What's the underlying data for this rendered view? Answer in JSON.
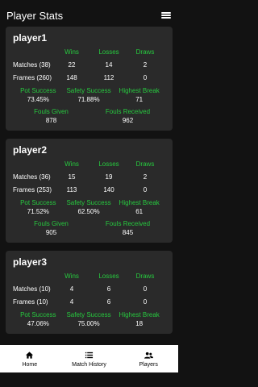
{
  "app": {
    "title": "Player Stats"
  },
  "headers": {
    "wins": "Wins",
    "losses": "Losses",
    "draws": "Draws",
    "pot": "Pot Success",
    "safety": "Safety Success",
    "highest": "Highest Break",
    "fouls_given": "Fouls Given",
    "fouls_received": "Fouls Received"
  },
  "players": [
    {
      "name": "player1",
      "matches": {
        "label": "Matches (38)",
        "wins": "22",
        "losses": "14",
        "draws": "2"
      },
      "frames": {
        "label": "Frames (260)",
        "wins": "148",
        "losses": "112",
        "draws": "0"
      },
      "pot": "73.45%",
      "safety": "71.88%",
      "highest": "71",
      "fouls_given": "878",
      "fouls_received": "962"
    },
    {
      "name": "player2",
      "matches": {
        "label": "Matches (36)",
        "wins": "15",
        "losses": "19",
        "draws": "2"
      },
      "frames": {
        "label": "Frames (253)",
        "wins": "113",
        "losses": "140",
        "draws": "0"
      },
      "pot": "71.52%",
      "safety": "62.50%",
      "highest": "61",
      "fouls_given": "905",
      "fouls_received": "845"
    },
    {
      "name": "player3",
      "matches": {
        "label": "Matches (10)",
        "wins": "4",
        "losses": "6",
        "draws": "0"
      },
      "frames": {
        "label": "Frames (10)",
        "wins": "4",
        "losses": "6",
        "draws": "0"
      },
      "pot": "47.06%",
      "safety": "75.00%",
      "highest": "18"
    }
  ],
  "nav": {
    "home": "Home",
    "history": "Match History",
    "players": "Players"
  },
  "colors": {
    "accent": "#27c93f",
    "card": "#2a2a2a",
    "background": "#121212"
  }
}
